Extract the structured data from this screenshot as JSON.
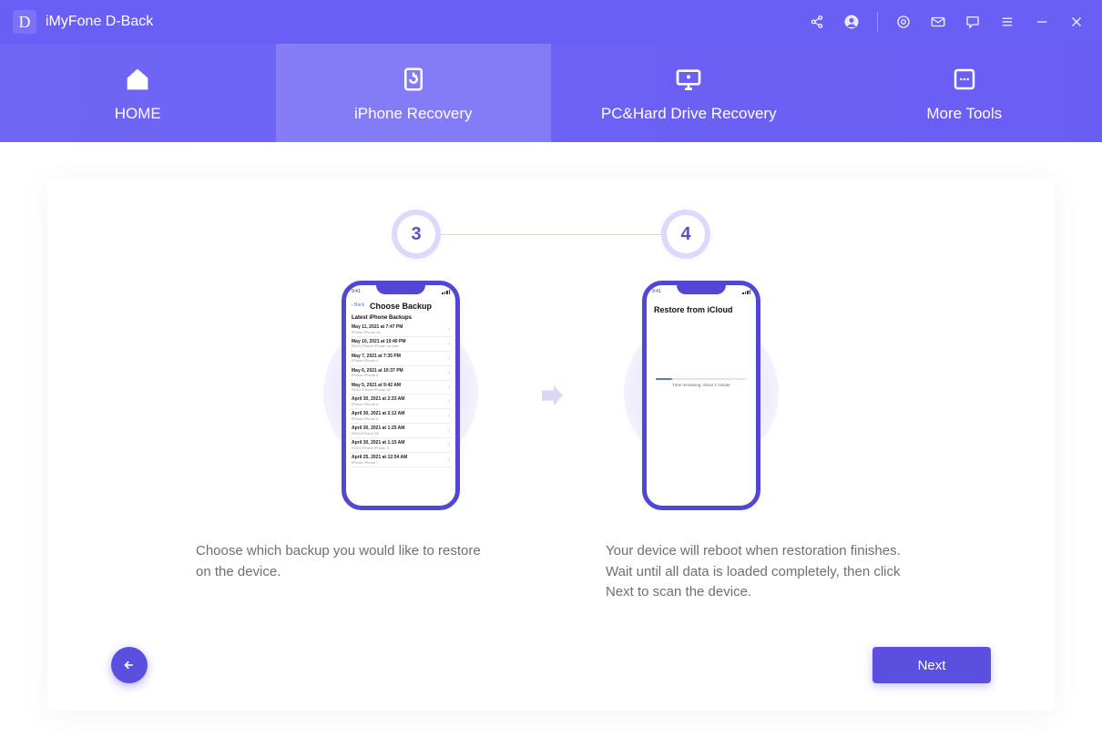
{
  "app": {
    "badge_letter": "D",
    "title": "iMyFone D-Back"
  },
  "tabs": {
    "home": "HOME",
    "iphone": "iPhone Recovery",
    "pc": "PC&Hard Drive Recovery",
    "tools": "More Tools"
  },
  "steps": {
    "left": "3",
    "right": "4"
  },
  "phone_left": {
    "back": "‹ Back",
    "title": "Choose Backup",
    "subhead": "Latest iPhone Backups",
    "items": [
      {
        "date": "May 11, 2021 at 7:47 PM",
        "sub": "iPhone iPhone Xs"
      },
      {
        "date": "May 10, 2021 at 10:40 PM",
        "sub": "RD31 iPhone iPhone Xs Max"
      },
      {
        "date": "May 7, 2021 at 7:35 PM",
        "sub": "iPhone iPhone X"
      },
      {
        "date": "May 6, 2021 at 10:37 PM",
        "sub": "iPhone iPhone 8"
      },
      {
        "date": "May 5, 2021 at 9:42 AM",
        "sub": "RD31 iPhone iPhone Xs"
      },
      {
        "date": "April 30, 2021 at 2:33 AM",
        "sub": "iPhone iPhone 6"
      },
      {
        "date": "April 30, 2021 at 2:12 AM",
        "sub": "iPhone iPhone 6"
      },
      {
        "date": "April 30, 2021 at 1:25 AM",
        "sub": "RD31 iPhone SE"
      },
      {
        "date": "April 30, 2021 at 1:15 AM",
        "sub": "RD31 iPhone iPhone X"
      },
      {
        "date": "April 25, 2021 at 12:54 AM",
        "sub": "iPhone iPhone 7"
      }
    ]
  },
  "phone_right": {
    "title": "Restore from iCloud",
    "caption": "Time remaining: About 1 minute"
  },
  "descriptions": {
    "left": "Choose which backup you would like to restore on the device.",
    "right": "Your device will reboot when restoration finishes.\nWait until all data is loaded completely, then click Next to scan the device."
  },
  "buttons": {
    "next": "Next"
  }
}
